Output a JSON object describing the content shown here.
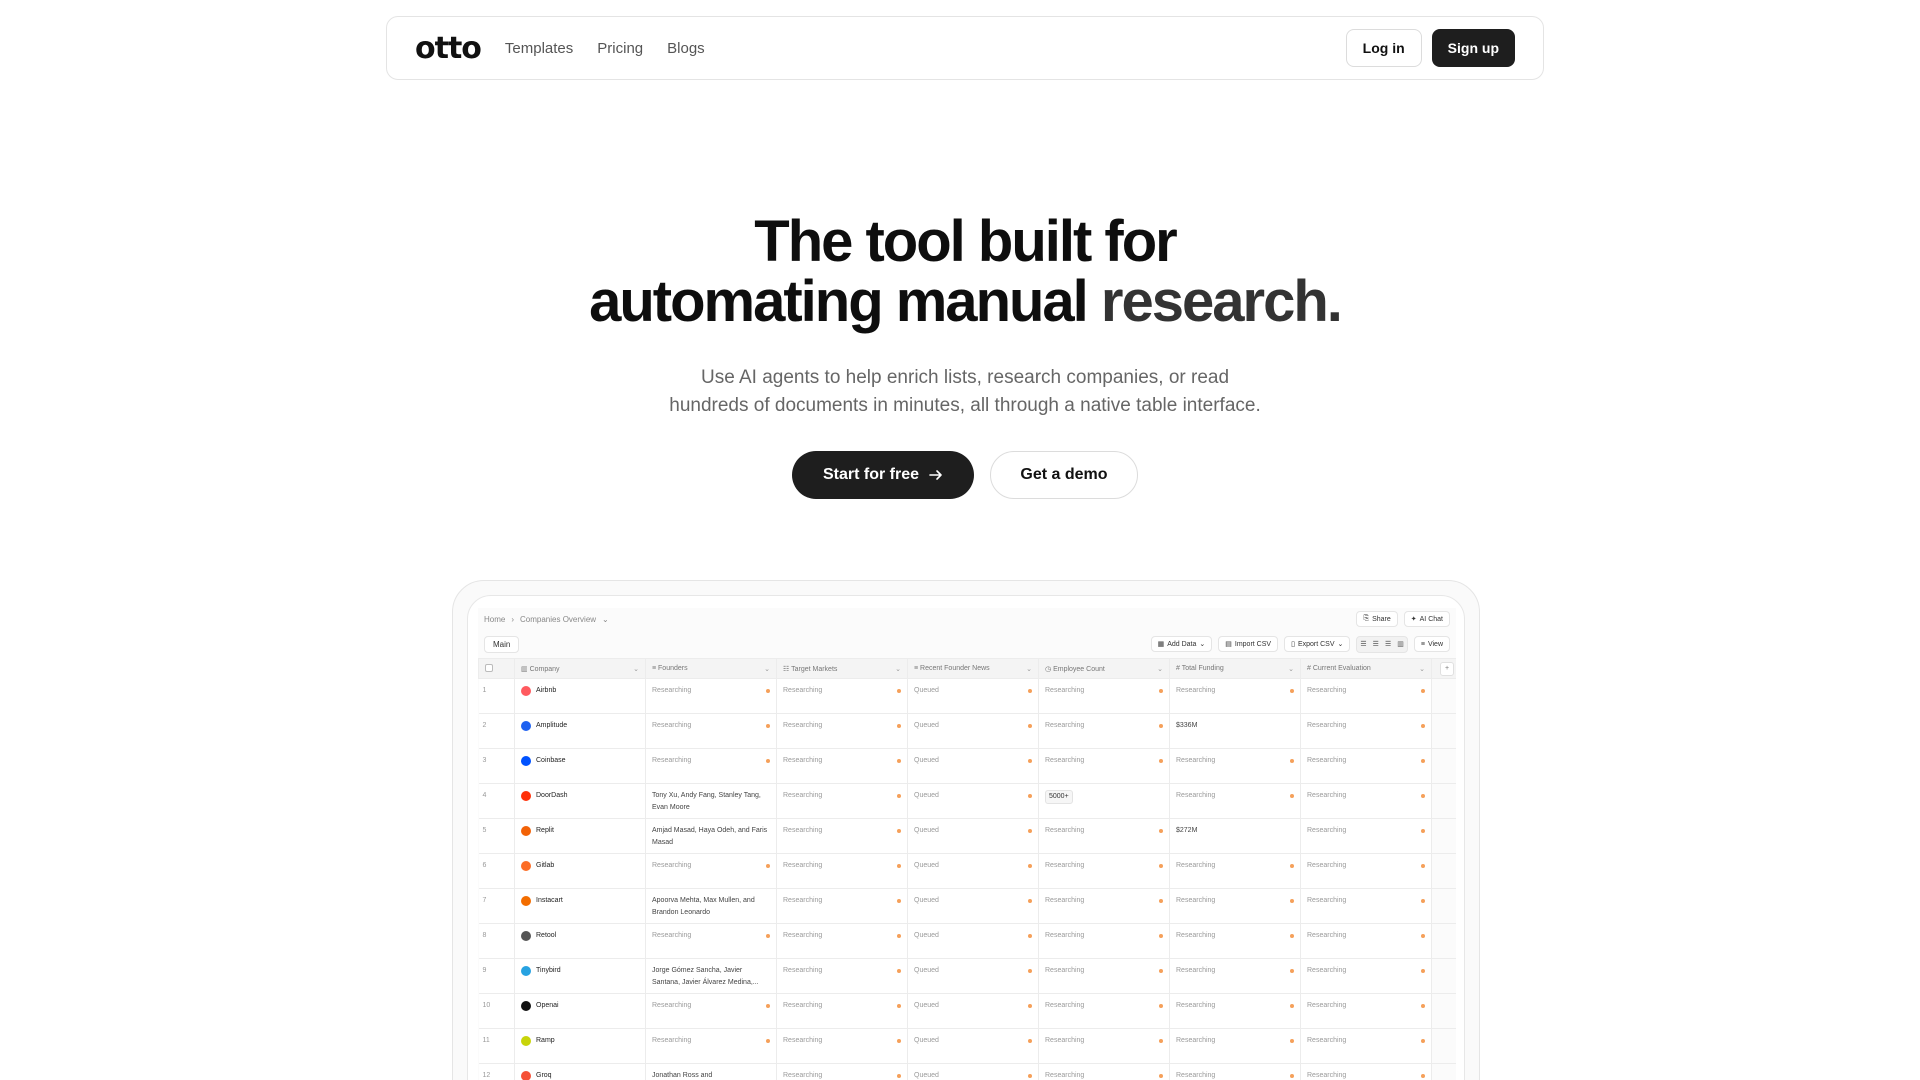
{
  "nav": {
    "logo": "otto",
    "links": [
      "Templates",
      "Pricing",
      "Blogs"
    ],
    "login": "Log in",
    "signup": "Sign up"
  },
  "hero": {
    "title_line1": "The tool built for",
    "title_line2a": "automating manual",
    "title_line2b": "research.",
    "sub_line1": "Use AI agents to help enrich lists, research companies, or read",
    "sub_line2": "hundreds of documents in minutes, all through a native table interface.",
    "cta_primary": "Start for free",
    "cta_secondary": "Get a demo"
  },
  "app": {
    "breadcrumb_home": "Home",
    "breadcrumb_page": "Companies Overview",
    "share": "Share",
    "ai_chat": "AI Chat",
    "tab_main": "Main",
    "add_data": "Add Data",
    "import_csv": "Import CSV",
    "export_csv": "Export CSV",
    "view": "View",
    "columns": [
      "Company",
      "Founders",
      "Target Markets",
      "Recent Founder News",
      "Employee Count",
      "Total Funding",
      "Current Evaluation"
    ],
    "rows": [
      {
        "n": "1",
        "company": "Airbnb",
        "icon_color": "#ff5a5f",
        "founders": "Researching",
        "markets": "Researching",
        "news": "Queued",
        "employees": "Researching",
        "funding": "Researching",
        "evaluation": "Researching"
      },
      {
        "n": "2",
        "company": "Amplitude",
        "icon_color": "#1e61f0",
        "founders": "Researching",
        "markets": "Researching",
        "news": "Queued",
        "employees": "Researching",
        "funding": "$336M",
        "evaluation": "Researching"
      },
      {
        "n": "3",
        "company": "Coinbase",
        "icon_color": "#0052ff",
        "founders": "Researching",
        "markets": "Researching",
        "news": "Queued",
        "employees": "Researching",
        "funding": "Researching",
        "evaluation": "Researching"
      },
      {
        "n": "4",
        "company": "DoorDash",
        "icon_color": "#ff3008",
        "founders": "Tony Xu, Andy Fang, Stanley Tang, Evan Moore",
        "markets": "Researching",
        "news": "Queued",
        "employees": "5000+",
        "funding": "Researching",
        "evaluation": "Researching"
      },
      {
        "n": "5",
        "company": "Replit",
        "icon_color": "#f26207",
        "founders": "Amjad Masad, Haya Odeh, and Faris Masad",
        "markets": "Researching",
        "news": "Queued",
        "employees": "Researching",
        "funding": "$272M",
        "evaluation": "Researching"
      },
      {
        "n": "6",
        "company": "Gitlab",
        "icon_color": "#fc6d26",
        "founders": "Researching",
        "markets": "Researching",
        "news": "Queued",
        "employees": "Researching",
        "funding": "Researching",
        "evaluation": "Researching"
      },
      {
        "n": "7",
        "company": "Instacart",
        "icon_color": "#f36d00",
        "founders": "Apoorva Mehta, Max Mullen, and Brandon Leonardo",
        "markets": "Researching",
        "news": "Queued",
        "employees": "Researching",
        "funding": "Researching",
        "evaluation": "Researching"
      },
      {
        "n": "8",
        "company": "Retool",
        "icon_color": "#555555",
        "founders": "Researching",
        "markets": "Researching",
        "news": "Queued",
        "employees": "Researching",
        "funding": "Researching",
        "evaluation": "Researching"
      },
      {
        "n": "9",
        "company": "Tinybird",
        "icon_color": "#27a2e1",
        "founders": "Jorge Gómez Sancha, Javier Santana, Javier Álvarez Medina,...",
        "markets": "Researching",
        "news": "Queued",
        "employees": "Researching",
        "funding": "Researching",
        "evaluation": "Researching"
      },
      {
        "n": "10",
        "company": "Openai",
        "icon_color": "#111111",
        "founders": "Researching",
        "markets": "Researching",
        "news": "Queued",
        "employees": "Researching",
        "funding": "Researching",
        "evaluation": "Researching"
      },
      {
        "n": "11",
        "company": "Ramp",
        "icon_color": "#c8d40a",
        "founders": "Researching",
        "markets": "Researching",
        "news": "Queued",
        "employees": "Researching",
        "funding": "Researching",
        "evaluation": "Researching"
      },
      {
        "n": "12",
        "company": "Groq",
        "icon_color": "#f55036",
        "founders": "Jonathan Ross and",
        "markets": "Researching",
        "news": "Queued",
        "employees": "Researching",
        "funding": "Researching",
        "evaluation": "Researching"
      }
    ]
  }
}
